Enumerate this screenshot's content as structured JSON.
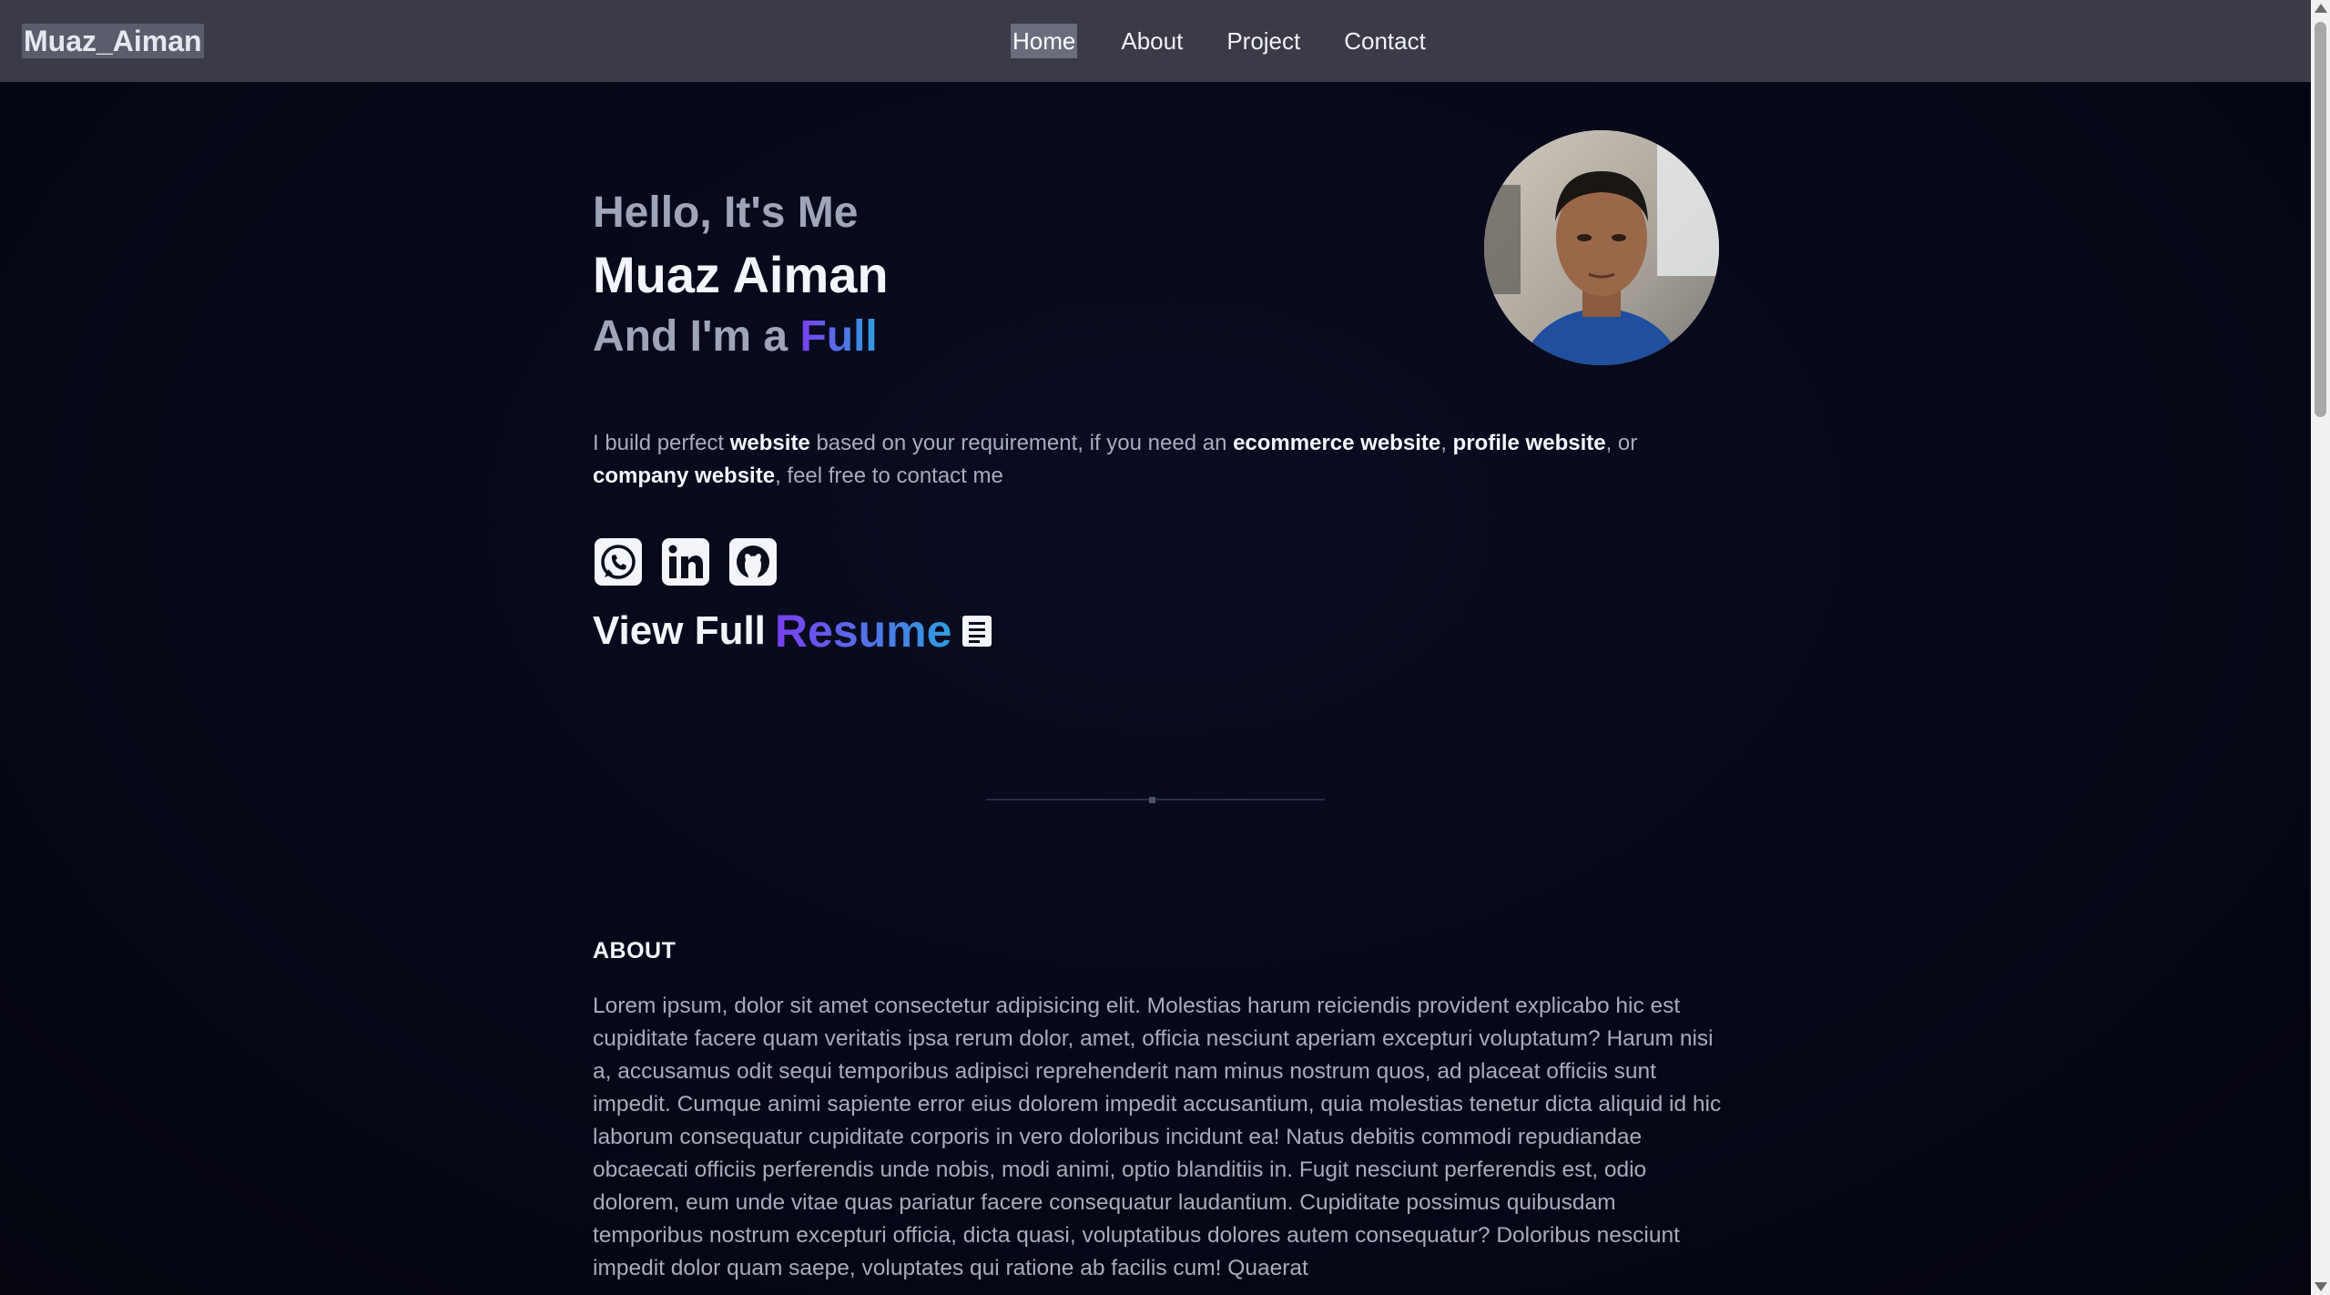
{
  "nav": {
    "brand": "Muaz_Aiman",
    "links": [
      "Home",
      "About",
      "Project",
      "Contact"
    ],
    "active": "Home"
  },
  "hero": {
    "greeting": "Hello, It's Me",
    "name": "Muaz Aiman",
    "role_prefix": "And I'm a ",
    "role_highlight": "Full",
    "intro": {
      "p1": "I build perfect ",
      "b1": "website",
      "p2": " based on your requirement, if you need an ",
      "b2": "ecommerce website",
      "p3": ", ",
      "b3": "profile website",
      "p4": ", or ",
      "b4": "company website",
      "p5": ", feel free to contact me"
    },
    "socials": [
      "whatsapp-icon",
      "linkedin-icon",
      "github-icon"
    ],
    "resume_prefix": "View Full ",
    "resume_highlight": "Resume",
    "resume_icon": "document-icon"
  },
  "about": {
    "title": "ABOUT",
    "text": "Lorem ipsum, dolor sit amet consectetur adipisicing elit. Molestias harum reiciendis provident explicabo hic est cupiditate facere quam veritatis ipsa rerum dolor, amet, officia nesciunt aperiam excepturi voluptatum? Harum nisi a, accusamus odit sequi temporibus adipisci reprehenderit nam minus nostrum quos, ad placeat officiis sunt impedit. Cumque animi sapiente error eius dolorem impedit accusantium, quia molestias tenetur dicta aliquid id hic laborum consequatur cupiditate corporis in vero doloribus incidunt ea! Natus debitis commodi repudiandae obcaecati officiis perferendis unde nobis, modi animi, optio blanditiis in. Fugit nesciunt perferendis est, odio dolorem, eum unde vitae quas pariatur facere consequatur laudantium. Cupiditate possimus quibusdam temporibus nostrum excepturi officia, dicta quasi, voluptatibus dolores autem consequatur? Doloribus nesciunt impedit dolor quam saepe, voluptates qui ratione ab facilis cum! Quaerat"
  },
  "colors": {
    "background": "#050714",
    "navbar": "#3a3b47",
    "gradient_start": "#7a3ef0",
    "gradient_end": "#2f9fe0",
    "muted_text": "#a7acbb"
  }
}
